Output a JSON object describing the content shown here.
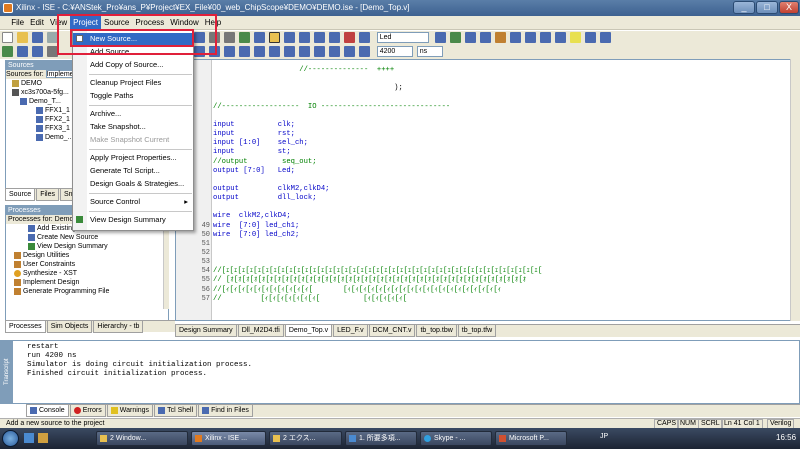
{
  "window": {
    "title": "Xilinx - ISE - C:¥ANStek_Pro¥ans_P¥Project¥EX_File¥00_web_ChipScope¥DEMO¥DEMO.ise - [Demo_Top.v]",
    "min": "_",
    "max": "□",
    "close": "X"
  },
  "menubar": {
    "items": [
      "File",
      "Edit",
      "View",
      "Project",
      "Source",
      "Process",
      "Window",
      "Help"
    ]
  },
  "toolbar": {
    "sel_top": "Led",
    "sel_time": "4200",
    "sel_unit": "ns"
  },
  "sources": {
    "title": "Sources",
    "for_label": "Sources for:",
    "for_value": "Impleme",
    "tree": [
      "DEMO",
      "xc3s700a-5fg...",
      "Demo_T...",
      "FFX1_1",
      "FFX2_1",
      "FFX3_1",
      "Demo_..."
    ]
  },
  "left_tabs1": [
    "Source",
    "Files",
    "Sn"
  ],
  "processes": {
    "title": "Processes",
    "for_label": "Processes for: Demo_",
    "items": [
      "Add Existing Source",
      "Create New Source",
      "View Design Summary",
      "Design Utilities",
      "User Constraints",
      "Synthesize - XST",
      "Implement Design",
      "Generate Programming File"
    ]
  },
  "left_tabs2": [
    "Processes",
    "Sim Objects",
    "Hierarchy - tb"
  ],
  "editor": {
    "lines": [
      {
        "n": "",
        "t": "                    //--------------  ++++",
        "c": "c"
      },
      {
        "n": "",
        "t": "",
        "c": ""
      },
      {
        "n": "",
        "t": "                                          );",
        "c": ""
      },
      {
        "n": "",
        "t": "",
        "c": ""
      },
      {
        "n": "",
        "t": "//------------------  IO ------------------------------",
        "c": "c"
      },
      {
        "n": "",
        "t": "",
        "c": ""
      },
      {
        "n": "",
        "t": "input          clk;",
        "c": "k"
      },
      {
        "n": "",
        "t": "input          rst;",
        "c": "k"
      },
      {
        "n": "",
        "t": "input [1:0]    sel_ch;",
        "c": "k"
      },
      {
        "n": "",
        "t": "input          st;",
        "c": "k"
      },
      {
        "n": "",
        "t": "//output        seq_out;",
        "c": "c"
      },
      {
        "n": "",
        "t": "output [7:0]   Led;",
        "c": "k"
      },
      {
        "n": "",
        "t": "",
        "c": ""
      },
      {
        "n": "",
        "t": "output         clkM2,clkD4;",
        "c": "k"
      },
      {
        "n": "",
        "t": "output         dll_lock;",
        "c": "k"
      },
      {
        "n": "",
        "t": "",
        "c": ""
      },
      {
        "n": "",
        "t": "wire  clkM2,clkD4;",
        "c": "k"
      },
      {
        "n": "49",
        "t": "wire  [7:0] led_ch1;",
        "c": "k"
      },
      {
        "n": "50",
        "t": "wire  [7:0] led_ch2;",
        "c": "k"
      },
      {
        "n": "51",
        "t": "",
        "c": ""
      },
      {
        "n": "52",
        "t": "",
        "c": ""
      },
      {
        "n": "53",
        "t": "",
        "c": ""
      },
      {
        "n": "54",
        "t": "//[ｪ[ｪ[ｪ[ｪ[ｪ[ｪ[ｪ[ｪ[ｪ[ｪ[ｪ[ｪ[ｪ[ｪ[ｪ[ｪ[ｪ[ｪ[ｪ[ｪ[ｪ[ｪ[ｪ[ｪ[ｪ[ｪ[ｪ[ｪ[ｪ[ｪ[ｪ[ｪ[ｪ[ｪ[ｪ[ｪ[ｪ[ｪ[ｪ[ｪ[",
        "c": "c"
      },
      {
        "n": "55",
        "t": "// [ｫ[ｫ[ｫ[ｫ[ｫ[ｫ[ｫ[ｫ[ｫ[ｫ[ｫ[ｫ[ｫ[ｫ[ｫ[ｫ[ｫ[ｫ[ｫ[ｫ[ｫ[ｫ[ｫ[ｫ[ｫ[ｫ[ｫ[ｫ[ｫ[ｫ[ｫ[ｫ[ｫ[ｫ[ｫ[ｫ[ｫ[ｫ",
        "c": "c"
      },
      {
        "n": "56",
        "t": "//[ｨ[ｨ[ｨ[ｨ[ｨ[ｨ[ｨ[ｨ[ｨ[ｨ[ｨ[       [ｨ[ｨ[ｨ[ｨ[ｨ[ｨ[ｨ[ｨ[ｨ[ｨ[ｨ[ｨ[ｨ[ｨ[ｨ[ｨ[ｨ[ｨ[ｨ[ｨ",
        "c": "c"
      },
      {
        "n": "57",
        "t": "//         [ｨ[ｨ[ｨ[ｨ[ｨ[ｨ[ｨ[          [ｨ[ｨ[ｨ[ｨ[ｨ[",
        "c": "c"
      }
    ]
  },
  "editor_tabs": [
    "Design Summary",
    "Dll_M2D4.tfi",
    "Demo_Top.v",
    "LED_F.v",
    "DCM_CNT.v",
    "tb_top.tbw",
    "tb_top.tfw"
  ],
  "console": {
    "lines": [
      "restart",
      "run 4200 ns",
      "Simulator is doing circuit initialization process.",
      "Finished circuit initialization process."
    ],
    "side_label": "Transcript"
  },
  "console_tabs": [
    "Console",
    "Errors",
    "Warnings",
    "Tcl Shell",
    "Find in Files"
  ],
  "status": {
    "message": "Add a new source to the project",
    "caps": "CAPS",
    "num": "NUM",
    "scrl": "SCRL",
    "position": "Ln 41 Col 1",
    "lang": "Verilog"
  },
  "taskbar": {
    "items": [
      "2 Window...",
      "Xilinx - ISE ...",
      "2 エクス...",
      "1. 所要多項...",
      "Skype - ...",
      "Microsoft P..."
    ],
    "lang": "JP",
    "time": "16:56"
  },
  "project_menu": {
    "items": [
      {
        "label": "New Source...",
        "state": "highlight"
      },
      {
        "label": "Add Source...",
        "state": ""
      },
      {
        "label": "Add Copy of Source...",
        "state": ""
      },
      {
        "label": "Cleanup Project Files",
        "state": ""
      },
      {
        "label": "Toggle Paths",
        "state": ""
      },
      {
        "label": "Archive...",
        "state": ""
      },
      {
        "label": "Take Snapshot...",
        "state": ""
      },
      {
        "label": "Make Snapshot Current",
        "state": "disabled"
      },
      {
        "label": "Apply Project Properties...",
        "state": ""
      },
      {
        "label": "Generate Tcl Script...",
        "state": ""
      },
      {
        "label": "Design Goals & Strategies...",
        "state": ""
      },
      {
        "label": "Source Control",
        "state": "submenu"
      },
      {
        "label": "View Design Summary",
        "state": ""
      }
    ]
  },
  "colors": {
    "highlight": "#316ac5",
    "annotation": "#e0203a",
    "keyword": "#0000c8",
    "comment": "#008000"
  }
}
